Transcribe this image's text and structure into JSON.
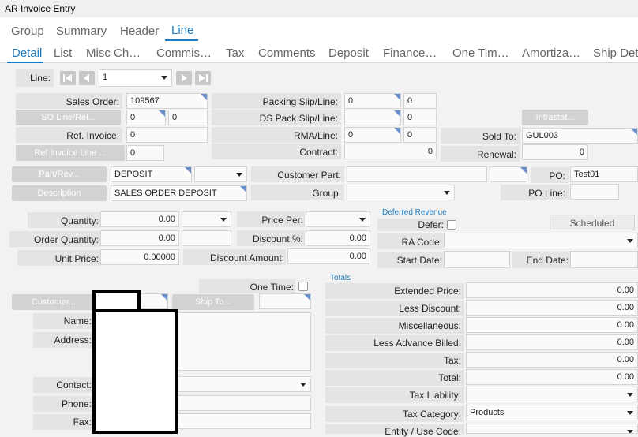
{
  "window": {
    "title": "AR Invoice Entry"
  },
  "tabs_top": [
    {
      "label": "Group"
    },
    {
      "label": "Summary"
    },
    {
      "label": "Header"
    },
    {
      "label": "Line"
    }
  ],
  "tabs_sub": [
    {
      "label": "Detail"
    },
    {
      "label": "List"
    },
    {
      "label": "Misc Ch…"
    },
    {
      "label": "Commis…"
    },
    {
      "label": "Tax"
    },
    {
      "label": "Comments"
    },
    {
      "label": "Deposit"
    },
    {
      "label": "Finance…"
    },
    {
      "label": "One Tim…"
    },
    {
      "label": "Amortiza…"
    },
    {
      "label": "Ship Det"
    }
  ],
  "line": {
    "label": "Line:",
    "value": "1"
  },
  "left": {
    "sales_order_label": "Sales Order:",
    "sales_order": "109567",
    "so_line_button": "SO Line/Rel...",
    "so_line": "0",
    "so_rel": "0",
    "ref_invoice_label": "Ref. Invoice:",
    "ref_invoice": "0",
    "ref_invoice_line_button": "Ref Invoice Line ...",
    "ref_invoice_line": "0",
    "part_button": "Part/Rev...",
    "part": "DEPOSIT",
    "description_button": "Description",
    "description": "SALES ORDER DEPOSIT"
  },
  "middle": {
    "packing_slip_label": "Packing Slip/Line:",
    "packing_slip": "0",
    "packing_line": "0",
    "ds_pack_label": "DS Pack Slip/Line:",
    "ds_pack_line": "0",
    "rma_label": "RMA/Line:",
    "rma": "0",
    "rma_line": "0",
    "contract_label": "Contract:",
    "contract": "0",
    "customer_part_label": "Customer Part:",
    "group_label": "Group:"
  },
  "right": {
    "intrastat_button": "Intrastat...",
    "sold_to_label": "Sold To:",
    "sold_to": "GUL003",
    "renewal_label": "Renewal:",
    "renewal": "0",
    "po_label": "PO:",
    "po": "Test01",
    "po_line_label": "PO Line:"
  },
  "qty": {
    "quantity_label": "Quantity:",
    "quantity": "0.00",
    "order_quantity_label": "Order Quantity:",
    "order_quantity": "0.00",
    "unit_price_label": "Unit Price:",
    "unit_price": "0.00000",
    "price_per_label": "Price Per:",
    "discount_pct_label": "Discount %:",
    "discount_pct": "0.00",
    "discount_amount_label": "Discount Amount:",
    "discount_amount": "0.00"
  },
  "deferred": {
    "section_title": "Deferred Revenue",
    "defer_label": "Defer:",
    "scheduled_label": "Scheduled",
    "ra_code_label": "RA Code:",
    "start_date_label": "Start Date:",
    "end_date_label": "End Date:"
  },
  "customer": {
    "one_time_label": "One Time:",
    "customer_button": "Customer...",
    "ship_to_button": "Ship To...",
    "name_label": "Name:",
    "address_label": "Address:",
    "contact_label": "Contact:",
    "phone_label": "Phone:",
    "fax_label": "Fax:"
  },
  "totals": {
    "section_title": "Totals",
    "extended_price_label": "Extended Price:",
    "extended_price": "0.00",
    "less_discount_label": "Less Discount:",
    "less_discount": "0.00",
    "miscellaneous_label": "Miscellaneous:",
    "miscellaneous": "0.00",
    "less_advance_label": "Less Advance Billed:",
    "less_advance": "0.00",
    "tax_label": "Tax:",
    "tax": "0.00",
    "total_label": "Total:",
    "total": "0.00",
    "tax_liability_label": "Tax Liability:",
    "tax_category_label": "Tax Category:",
    "tax_category": "Products",
    "entity_use_code_label": "Entity / Use Code:"
  },
  "colors": {
    "accent": "#1f7bbd",
    "corner_marker": "#6a8fc9"
  }
}
